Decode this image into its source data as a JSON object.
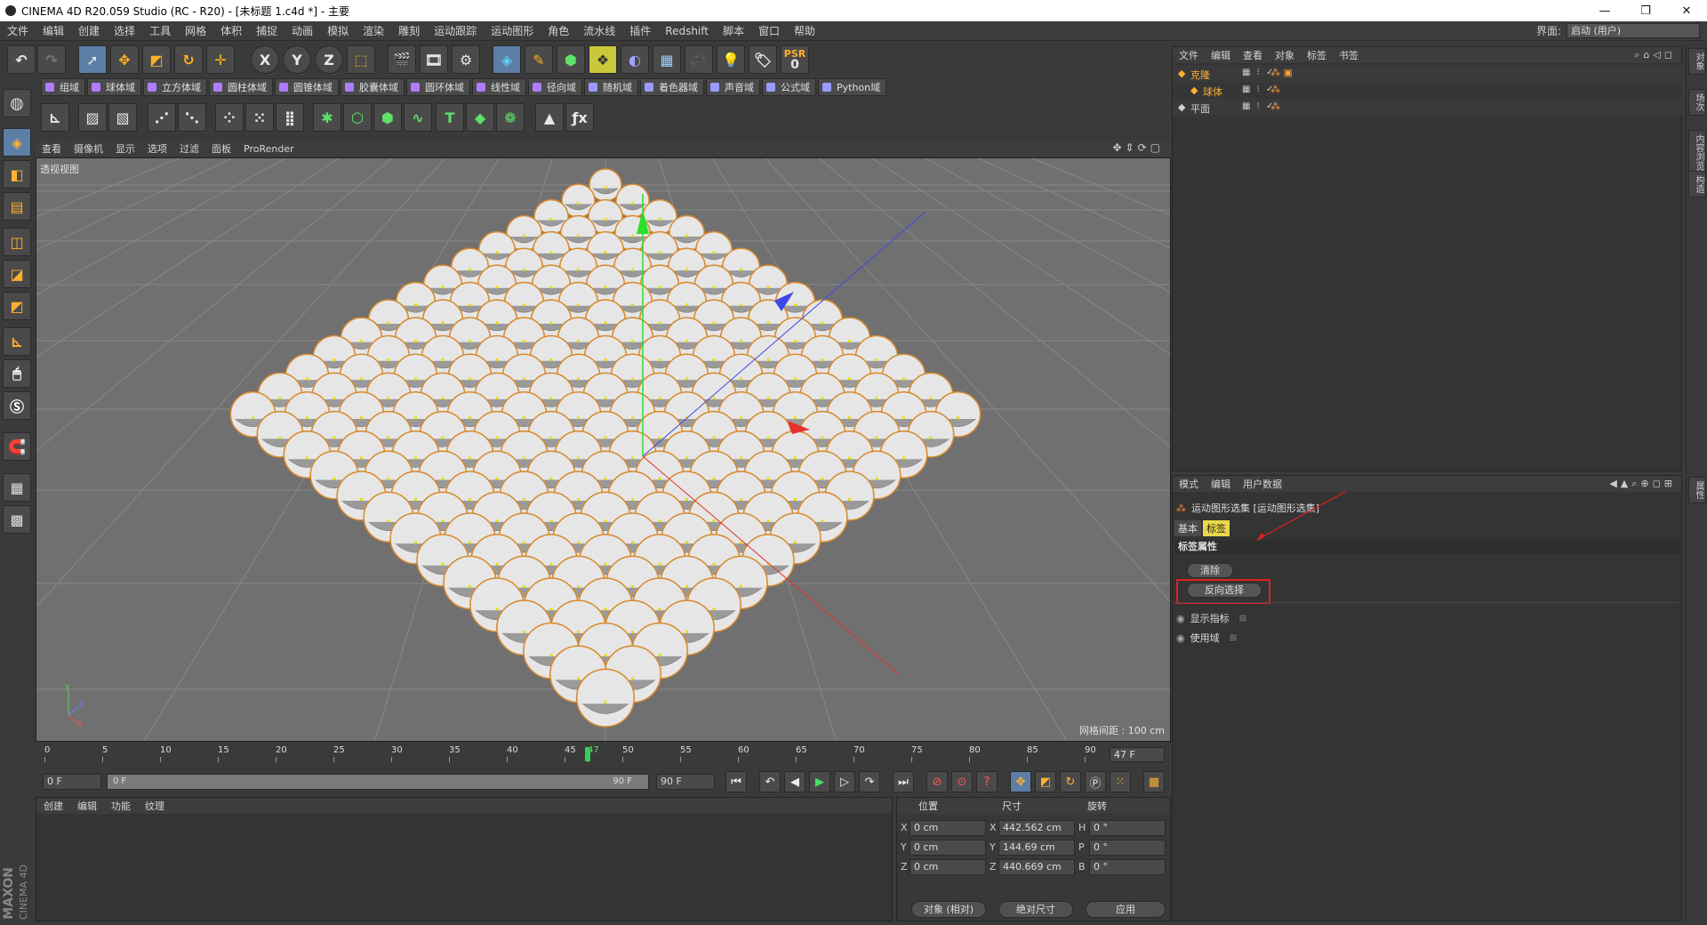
{
  "window": {
    "title": "CINEMA 4D R20.059 Studio (RC - R20) - [未标题 1.c4d *] - 主要",
    "controls": [
      "—",
      "❐",
      "✕"
    ]
  },
  "menubar": {
    "items": [
      "文件",
      "编辑",
      "创建",
      "选择",
      "工具",
      "网格",
      "体积",
      "捕捉",
      "动画",
      "模拟",
      "渲染",
      "雕刻",
      "运动跟踪",
      "运动图形",
      "角色",
      "流水线",
      "插件",
      "Redshift",
      "脚本",
      "窗口",
      "帮助"
    ],
    "layout_label": "界面:",
    "layout_value": "启动 (用户)"
  },
  "toolbar": {
    "icons": [
      "undo-icon",
      "redo-icon",
      "live-select-icon",
      "move-icon",
      "scale-icon",
      "rotate-icon",
      "recent-tools-icon",
      "x-axis-icon",
      "y-axis-icon",
      "z-axis-icon",
      "coordinate-system-icon",
      "render-view-icon",
      "render-picture-viewer-icon",
      "edit-render-settings-icon",
      "cube-icon",
      "pen-icon",
      "subdivision-icon",
      "cloner-icon",
      "deformer-icon",
      "floor-icon",
      "camera-icon",
      "light-icon",
      "tag-icon",
      "psr-icon"
    ],
    "psr_label": "PSR",
    "psr_value": "0"
  },
  "fields_row": [
    {
      "label": "组域",
      "color": "#b07cff"
    },
    {
      "label": "球体域",
      "color": "#b07cff"
    },
    {
      "label": "立方体域",
      "color": "#b07cff"
    },
    {
      "label": "圆柱体域",
      "color": "#b07cff"
    },
    {
      "label": "圆锥体域",
      "color": "#b07cff"
    },
    {
      "label": "胶囊体域",
      "color": "#b07cff"
    },
    {
      "label": "圆环体域",
      "color": "#b07cff"
    },
    {
      "label": "线性域",
      "color": "#b07cff"
    },
    {
      "label": "径向域",
      "color": "#b07cff"
    },
    {
      "label": "随机域",
      "color": "#9a9aff"
    },
    {
      "label": "着色器域",
      "color": "#9a9aff"
    },
    {
      "label": "声音域",
      "color": "#9a9aff"
    },
    {
      "label": "公式域",
      "color": "#9a9aff"
    },
    {
      "label": "Python域",
      "color": "#9a9aff"
    }
  ],
  "viewport": {
    "menu": [
      "查看",
      "摄像机",
      "显示",
      "选项",
      "过滤",
      "面板",
      "ProRender"
    ],
    "label": "透视视图",
    "grid_info": "网格间距 : 100 cm",
    "axes": {
      "x": "X",
      "y": "Y",
      "z": "Z"
    }
  },
  "timeline": {
    "ticks": [
      "0",
      "5",
      "10",
      "15",
      "20",
      "25",
      "30",
      "35",
      "40",
      "45",
      "47",
      "50",
      "55",
      "60",
      "65",
      "70",
      "75",
      "80",
      "85",
      "90"
    ],
    "current_frame": "47 F",
    "current_value": 47,
    "max_value": 90
  },
  "transport": {
    "start_field": "0 F",
    "range_start": "0 F",
    "range_end": "90 F",
    "end_field": "90 F"
  },
  "material_panel": {
    "menu": [
      "创建",
      "编辑",
      "功能",
      "纹理"
    ],
    "logo_line1": "MAXON",
    "logo_line2": "CINEMA 4D"
  },
  "coordinates": {
    "headers": [
      "位置",
      "尺寸",
      "旋转"
    ],
    "rows": [
      {
        "pos_axis": "X",
        "pos": "0 cm",
        "size_axis": "X",
        "size": "442.562 cm",
        "rot_axis": "H",
        "rot": "0 °"
      },
      {
        "pos_axis": "Y",
        "pos": "0 cm",
        "size_axis": "Y",
        "size": "144.69 cm",
        "rot_axis": "P",
        "rot": "0 °"
      },
      {
        "pos_axis": "Z",
        "pos": "0 cm",
        "size_axis": "Z",
        "size": "440.669 cm",
        "rot_axis": "B",
        "rot": "0 °"
      }
    ],
    "mode_dropdown": "对象 (相对)",
    "size_dropdown": "绝对尺寸",
    "apply_button": "应用"
  },
  "object_manager": {
    "menu": [
      "文件",
      "编辑",
      "查看",
      "对象",
      "标签",
      "书签"
    ],
    "objects": [
      {
        "name": "克隆",
        "color": "#ffb030",
        "indent": 0
      },
      {
        "name": "球体",
        "color": "#ffb030",
        "indent": 1
      },
      {
        "name": "平面",
        "color": "#d0d0d0",
        "indent": 0
      }
    ]
  },
  "attribute_manager": {
    "menu": [
      "模式",
      "编辑",
      "用户数据"
    ],
    "title": "运动图形选集 [运动图形选集]",
    "tabs": [
      "基本",
      "标签"
    ],
    "section": "标签属性",
    "clear_button": "清除",
    "invert_button": "反向选择",
    "options": [
      {
        "label": "显示指标"
      },
      {
        "label": "使用域"
      }
    ]
  },
  "right_tabs": [
    "对象",
    "场次",
    "内容浏览器",
    "构造"
  ],
  "right_tab_attr": "属性"
}
